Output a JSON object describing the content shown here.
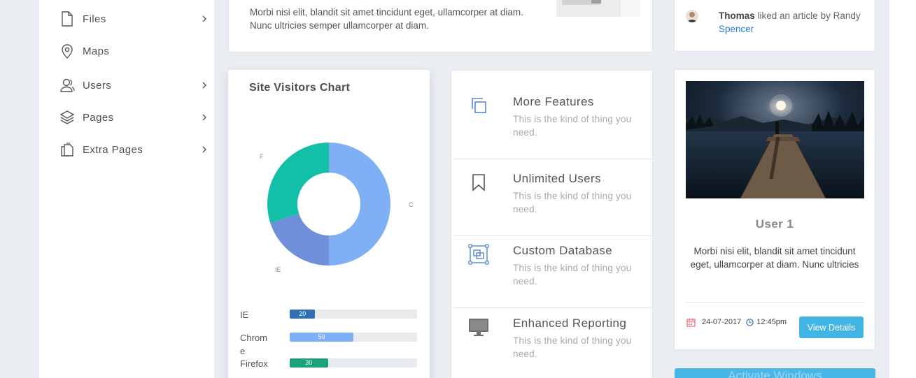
{
  "sidebar": {
    "items": [
      {
        "label": "Files",
        "icon": "file-icon",
        "has_submenu": true
      },
      {
        "label": "Maps",
        "icon": "map-pin-icon",
        "has_submenu": false
      },
      {
        "label": "Users",
        "icon": "users-icon",
        "has_submenu": true
      },
      {
        "label": "Pages",
        "icon": "layers-icon",
        "has_submenu": true
      },
      {
        "label": "Extra Pages",
        "icon": "copy-pages-icon",
        "has_submenu": true
      }
    ]
  },
  "top_card": {
    "text": "Morbi nisi elit, blandit sit amet tincidunt eget, ullamcorper at diam. Nunc ultricies semper ullamcorper at diam."
  },
  "activity": {
    "user": "Thomas",
    "action": " liked an article by Randy ",
    "link": "Spencer"
  },
  "visitors": {
    "title": "Site Visitors Chart",
    "bars": [
      {
        "label": "IE",
        "value": "20"
      },
      {
        "label": "Chrome",
        "value": "50"
      },
      {
        "label": "Firefox",
        "value": "30"
      }
    ]
  },
  "chart_data": {
    "type": "pie",
    "title": "Site Visitors Chart",
    "categories": [
      "C",
      "IE",
      "F"
    ],
    "values": [
      50,
      20,
      30
    ],
    "colors": [
      "#7fb0f5",
      "#6f8fd8",
      "#13bfa6"
    ],
    "bar_colors": [
      "#2f6fb5",
      "#7fb0f5",
      "#1aa37a"
    ]
  },
  "features": [
    {
      "title": "More Features",
      "desc": "This is the kind of thing you need.",
      "icon": "copy-icon"
    },
    {
      "title": "Unlimited Users",
      "desc": "This is the kind of thing you need.",
      "icon": "bookmark-icon"
    },
    {
      "title": "Custom Database",
      "desc": "This is the kind of thing you need.",
      "icon": "database-frame-icon"
    },
    {
      "title": "Enhanced Reporting",
      "desc": "This is the kind of thing you need.",
      "icon": "monitor-icon"
    }
  ],
  "user_card": {
    "name": "User 1",
    "desc": "Morbi nisi elit, blandit sit amet tincidunt eget, ullamcorper at diam. Nunc ultricies",
    "date": "24-07-2017",
    "time": "12:45pm",
    "button": "View Details"
  },
  "watermark": "Activate Windows"
}
